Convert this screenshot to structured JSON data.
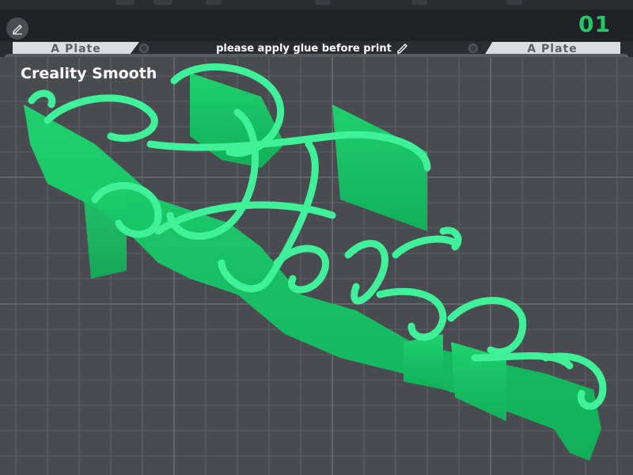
{
  "toolbar": {
    "plate_counter": "01"
  },
  "plates": {
    "left_label": "A Plate",
    "right_label": "A Plate",
    "note": "please apply glue before print"
  },
  "viewport": {
    "filament_name": "Creality Smooth",
    "model_text": "Haja",
    "model_color": "#22e07a"
  },
  "icons": {
    "edit": "pencil-icon",
    "note_edit": "pencil-icon"
  }
}
